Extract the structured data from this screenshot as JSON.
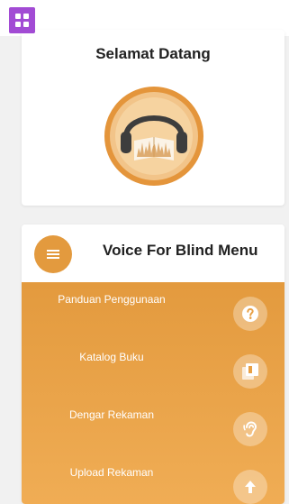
{
  "welcome": {
    "title": "Selamat Datang"
  },
  "menu": {
    "title": "Voice For Blind Menu",
    "toggle_icon": "menu-icon",
    "items": [
      {
        "label": "Panduan Penggunaan",
        "icon": "help-icon"
      },
      {
        "label": "Katalog Buku",
        "icon": "library-icon"
      },
      {
        "label": "Dengar Rekaman",
        "icon": "ear-icon"
      },
      {
        "label": "Upload Rekaman",
        "icon": "upload-icon"
      }
    ]
  },
  "colors": {
    "accent": "#e39a3e",
    "badge": "#a24bd4",
    "panel_light": "#f0ad55"
  }
}
